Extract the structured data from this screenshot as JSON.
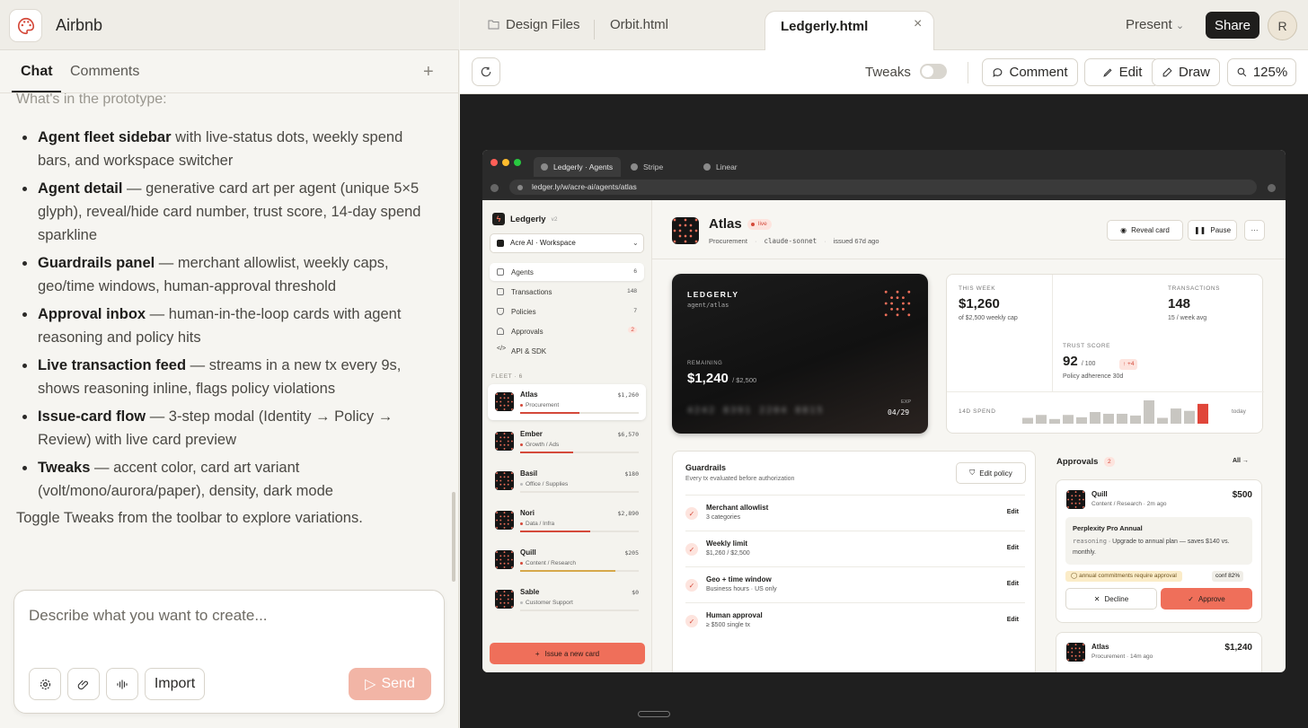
{
  "app": {
    "name": "Airbnb",
    "logo_icon": "palette-icon"
  },
  "left_tabs": {
    "chat": "Chat",
    "comments": "Comments",
    "add": "+"
  },
  "chat": {
    "cut_text": "What's in the prototype:",
    "features": [
      {
        "title": "Agent fleet sidebar",
        "text": " with live-status dots, weekly spend bars, and workspace switcher"
      },
      {
        "title": "Agent detail",
        "text": " — generative card art per agent (unique 5×5 glyph), reveal/hide card number, trust score, 14-day spend sparkline"
      },
      {
        "title": "Guardrails panel",
        "text": " — merchant allowlist, weekly caps, geo/time windows, human-approval threshold"
      },
      {
        "title": "Approval inbox",
        "text": " — human-in-the-loop cards with agent reasoning and policy hits"
      },
      {
        "title": "Live transaction feed",
        "text": " — streams in a new tx every 9s, shows reasoning inline, flags policy violations"
      },
      {
        "title": "Issue-card flow",
        "text": " — 3-step modal (Identity → Policy → Review) with live card preview"
      },
      {
        "title": "Tweaks",
        "text": " — accent color, card art variant (volt/mono/aurora/paper), density, dark mode"
      }
    ],
    "footer": "Toggle Tweaks from the toolbar to explore variations."
  },
  "composer": {
    "placeholder": "Describe what you want to create...",
    "import_label": "Import",
    "send_label": "Send"
  },
  "file_tabs": {
    "design": "Design Files",
    "orbit": "Orbit.html",
    "active": "Ledgerly.html",
    "close": "×"
  },
  "top_right": {
    "present": "Present",
    "share": "Share",
    "avatar": "R"
  },
  "toolbar": {
    "tweaks": "Tweaks",
    "comment": "Comment",
    "edit": "Edit",
    "draw": "Draw",
    "zoom": "125%"
  },
  "browser": {
    "tabs": [
      "Ledgerly · Agents",
      "Stripe",
      "Linear"
    ],
    "url": "ledger.ly/w/acre-ai/agents/atlas"
  },
  "sidebar": {
    "brand": "Ledgerly",
    "version": "v2",
    "workspace": "Acre AI · Workspace",
    "nav": [
      {
        "label": "Agents",
        "count": "6"
      },
      {
        "label": "Transactions",
        "count": "148"
      },
      {
        "label": "Policies",
        "count": "7"
      },
      {
        "label": "Approvals",
        "count": "2"
      },
      {
        "label": "API & SDK",
        "count": ""
      }
    ],
    "fleet_label": "FLEET · 6",
    "fleet": [
      {
        "name": "Atlas",
        "spend": "$1,260",
        "category": "Procurement",
        "progress": 0.5,
        "color": "#d4493a"
      },
      {
        "name": "Ember",
        "spend": "$6,570",
        "category": "Growth / Ads",
        "progress": 0.45,
        "color": "#d4493a"
      },
      {
        "name": "Basil",
        "spend": "$180",
        "category": "Office / Supplies",
        "progress": 0.0,
        "color": "#d4493a"
      },
      {
        "name": "Nori",
        "spend": "$2,890",
        "category": "Data / Infra",
        "progress": 0.59,
        "color": "#d4493a"
      },
      {
        "name": "Quill",
        "spend": "$205",
        "category": "Content / Research",
        "progress": 0.8,
        "color": "#d6a84a"
      },
      {
        "name": "Sable",
        "spend": "$0",
        "category": "Customer Support",
        "progress": 0.0,
        "color": "#bbbbbb"
      }
    ],
    "issue_button": "Issue a new card"
  },
  "agent": {
    "name": "Atlas",
    "status": "live",
    "role": "Procurement",
    "model": "claude-sonnet",
    "issued": "issued 67d ago",
    "reveal": "Reveal card",
    "pause": "Pause",
    "more": "···"
  },
  "card": {
    "brand": "LEDGERLY",
    "path": "agent/atlas",
    "remaining_label": "REMAINING",
    "remaining": "$1,240",
    "cap": "/ $2,500",
    "number": "4242 8391 2204 8815",
    "exp_label": "EXP",
    "exp": "04/29"
  },
  "stats": {
    "week_label": "THIS WEEK",
    "week_value": "$1,260",
    "week_sub": "of $2,500 weekly cap",
    "tx_label": "TRANSACTIONS",
    "tx_value": "148",
    "tx_sub": "15 / week avg",
    "trust_label": "TRUST SCORE",
    "trust_value": "92",
    "trust_max": "/ 100",
    "trust_delta": "↑ +4",
    "trust_sub": "Policy adherence 30d",
    "spark_label": "14D SPEND",
    "spark_today": "today"
  },
  "chart_data": {
    "type": "bar",
    "values": [
      1,
      1.5,
      0.8,
      1.5,
      1.1,
      2,
      1.7,
      1.7,
      1.4,
      4,
      1,
      2.6,
      2.2,
      3.4
    ],
    "highlight_last": true,
    "colors": {
      "bar": "#c8c6c1",
      "highlight": "#e0463a"
    }
  },
  "guardrails": {
    "title": "Guardrails",
    "subtitle": "Every tx evaluated before authorization",
    "edit_policy": "Edit policy",
    "rows": [
      {
        "name": "Merchant allowlist",
        "value": "3 categories",
        "edit": "Edit"
      },
      {
        "name": "Weekly limit",
        "value": "$1,260 / $2,500",
        "edit": "Edit"
      },
      {
        "name": "Geo + time window",
        "value": "Business hours · US only",
        "edit": "Edit"
      },
      {
        "name": "Human approval",
        "value": "≥ $500 single tx",
        "edit": "Edit"
      }
    ]
  },
  "approvals": {
    "title": "Approvals",
    "count": "2",
    "all": "All →",
    "items": [
      {
        "name": "Quill",
        "meta": "Content / Research · 2m ago",
        "amount": "$500",
        "reason_title": "Perplexity Pro Annual",
        "reason_keyword": "reasoning",
        "reason_text": " · Upgrade to annual plan — saves $140 vs. monthly.",
        "policy_hit": "◯ annual commitments require approval",
        "confidence": "conf 82%",
        "decline": "Decline",
        "approve": "Approve"
      },
      {
        "name": "Atlas",
        "meta": "Procurement · 14m ago",
        "amount": "$1,240"
      }
    ]
  },
  "colors": {
    "accent": "#ef6f5a",
    "accent_dark": "#d4493a",
    "send": "#f2b5a6",
    "share": "#1f1e1c"
  }
}
